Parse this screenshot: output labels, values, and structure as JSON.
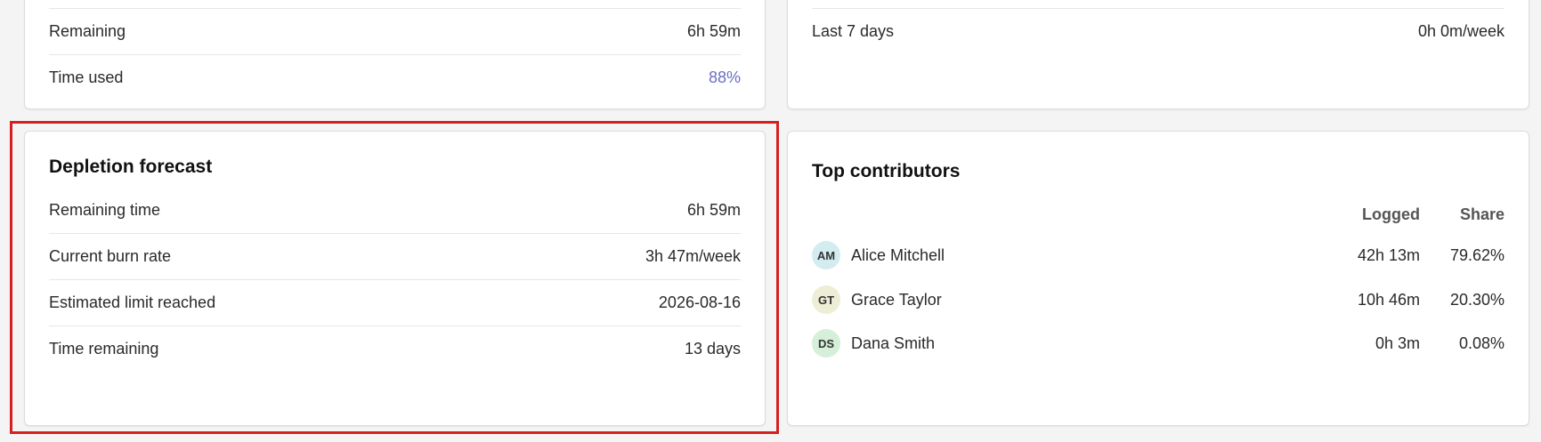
{
  "usage": {
    "remaining_label": "Remaining",
    "remaining_value": "6h 59m",
    "time_used_label": "Time used",
    "time_used_value": "88%"
  },
  "rate": {
    "last7_label": "Last 7 days",
    "last7_value": "0h 0m/week"
  },
  "forecast": {
    "title": "Depletion forecast",
    "rows": [
      {
        "label": "Remaining time",
        "value": "6h 59m"
      },
      {
        "label": "Current burn rate",
        "value": "3h 47m/week"
      },
      {
        "label": "Estimated limit reached",
        "value": "2026-08-16"
      },
      {
        "label": "Time remaining",
        "value": "13 days"
      }
    ]
  },
  "contributors": {
    "title": "Top contributors",
    "col_logged": "Logged",
    "col_share": "Share",
    "rows": [
      {
        "initials": "AM",
        "name": "Alice Mitchell",
        "logged": "42h 13m",
        "share": "79.62%",
        "color": "#d3ecef"
      },
      {
        "initials": "GT",
        "name": "Grace Taylor",
        "logged": "10h 46m",
        "share": "20.30%",
        "color": "#eeeed6"
      },
      {
        "initials": "DS",
        "name": "Dana Smith",
        "logged": "0h 3m",
        "share": "0.08%",
        "color": "#d5efd9"
      }
    ]
  },
  "colors": {
    "accent": "#6b6fc4",
    "highlight": "#d61f1f"
  }
}
